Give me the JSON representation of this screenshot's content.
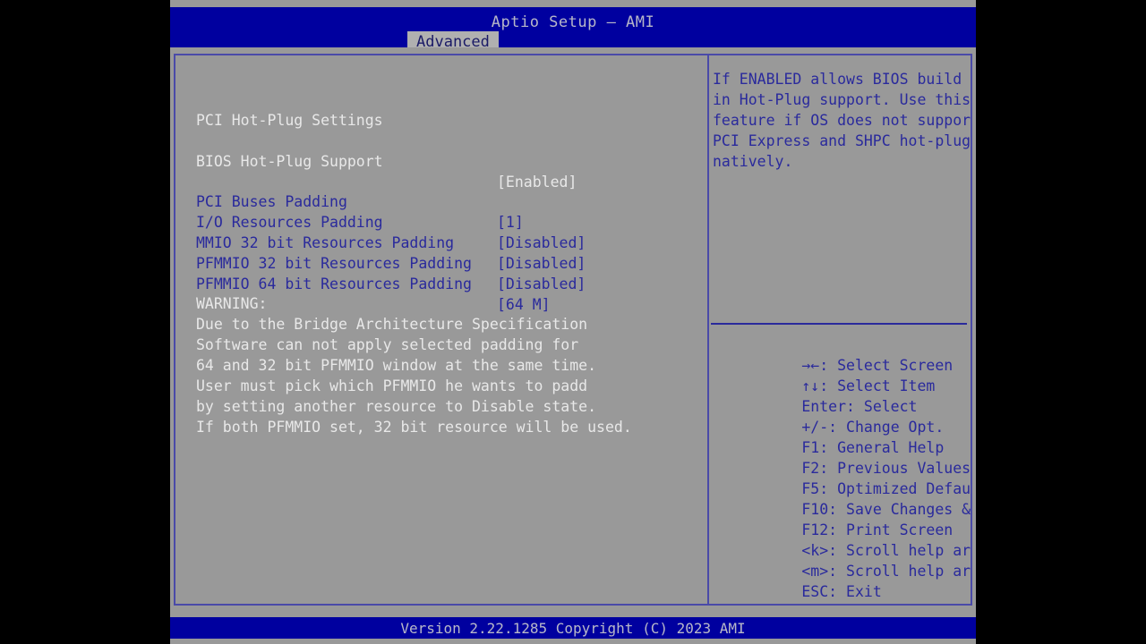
{
  "header": {
    "title": "Aptio Setup – AMI",
    "tabs": [
      {
        "label": "Advanced",
        "active": true
      }
    ]
  },
  "main": {
    "section_title": "PCI Hot-Plug Settings",
    "selected_item": {
      "label": "BIOS Hot-Plug Support",
      "value": "[Enabled]"
    },
    "settings": [
      {
        "label": "PCI Buses Padding",
        "value": "[1]"
      },
      {
        "label": "I/O Resources Padding",
        "value": "[Disabled]"
      },
      {
        "label": "MMIO 32 bit Resources Padding",
        "value": "[Disabled]"
      },
      {
        "label": "PFMMIO 32 bit Resources Padding",
        "value": "[Disabled]"
      },
      {
        "label": "PFMMIO 64 bit Resources Padding",
        "value": "[64 M]"
      }
    ],
    "warning": {
      "heading": "WARNING:",
      "lines": [
        "Due to the Bridge Architecture Specification",
        "Software can not apply selected padding for",
        "64 and 32 bit PFMMIO window at the same time.",
        "User must pick which PFMMIO he wants to padd",
        "by setting another resource to Disable state.",
        "If both PFMMIO set, 32 bit resource will be used."
      ]
    }
  },
  "help": {
    "lines": [
      "If ENABLED allows BIOS build",
      "in Hot-Plug support. Use this",
      "feature if OS does not support",
      "PCI Express and SHPC hot-plug",
      "natively."
    ]
  },
  "navigation": {
    "items": [
      {
        "key": "→←",
        "desc": ": Select Screen"
      },
      {
        "key": "↑↓",
        "desc": ": Select Item"
      },
      {
        "key": "Enter",
        "desc": ": Select"
      },
      {
        "key": "+/-",
        "desc": ": Change Opt."
      },
      {
        "key": "F1",
        "desc": ": General Help"
      },
      {
        "key": "F2",
        "desc": ": Previous Values"
      },
      {
        "key": "F5",
        "desc": ": Optimized Defaults"
      },
      {
        "key": "F10",
        "desc": ": Save Changes & Reset"
      },
      {
        "key": "F12",
        "desc": ": Print Screen"
      },
      {
        "key": "<k>",
        "desc": ": Scroll help area upwards"
      },
      {
        "key": "<m>",
        "desc": ": Scroll help area downwards"
      },
      {
        "key": "ESC",
        "desc": ": Exit"
      }
    ]
  },
  "footer": {
    "version_text": "Version 2.22.1285 Copyright (C) 2023 AMI"
  },
  "colors": {
    "header_blue": "#00009f",
    "background_gray": "#999999",
    "frame_border": "#4a4aa8",
    "text_blue": "#2a2a9c",
    "text_white": "#e8e8e8",
    "tab_active_bg": "#b0b0b0"
  }
}
